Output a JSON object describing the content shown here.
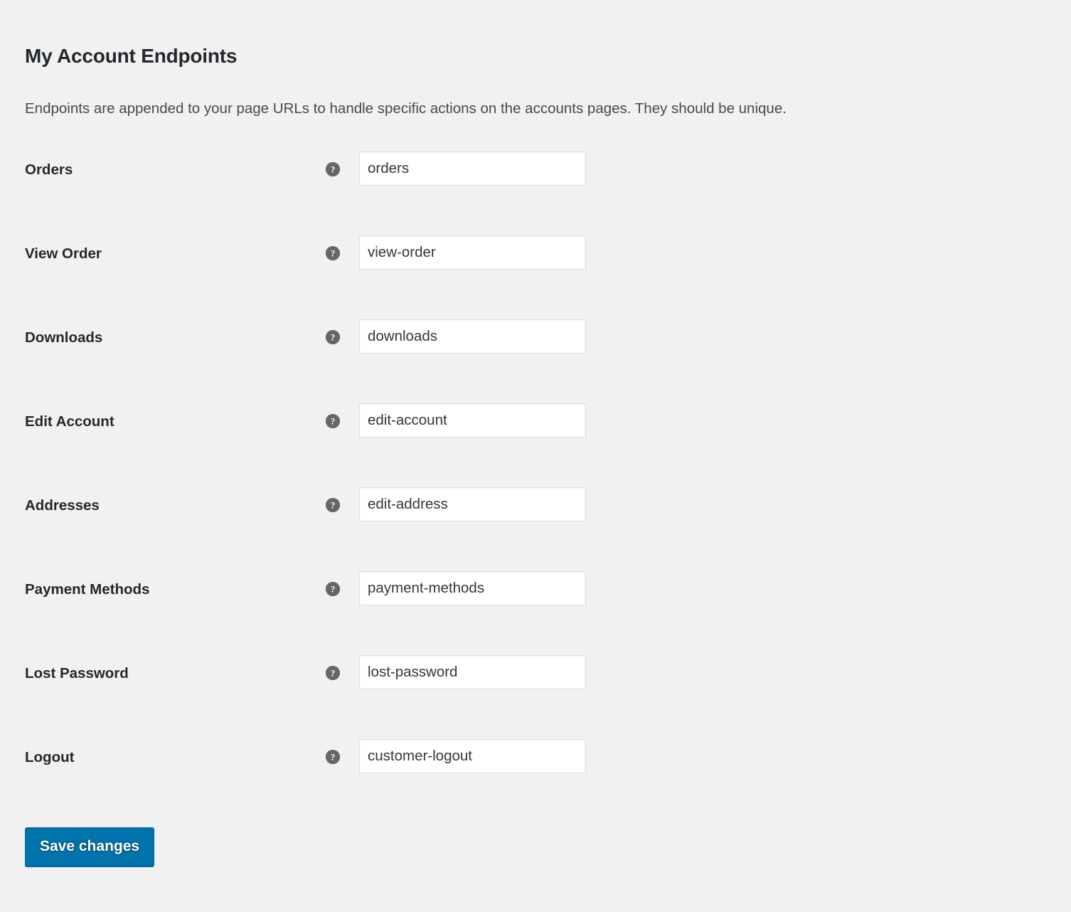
{
  "page": {
    "title": "My Account Endpoints",
    "description": "Endpoints are appended to your page URLs to handle specific actions on the accounts pages. They should be unique."
  },
  "colors": {
    "background": "#f1f1f1",
    "heading": "#23282d",
    "input_border": "#dddddd",
    "help_icon": "#666666",
    "primary_button": "#0073aa"
  },
  "fields": [
    {
      "label": "Orders",
      "value": "orders",
      "help_icon": "help-icon"
    },
    {
      "label": "View Order",
      "value": "view-order",
      "help_icon": "help-icon"
    },
    {
      "label": "Downloads",
      "value": "downloads",
      "help_icon": "help-icon"
    },
    {
      "label": "Edit Account",
      "value": "edit-account",
      "help_icon": "help-icon"
    },
    {
      "label": "Addresses",
      "value": "edit-address",
      "help_icon": "help-icon"
    },
    {
      "label": "Payment Methods",
      "value": "payment-methods",
      "help_icon": "help-icon"
    },
    {
      "label": "Lost Password",
      "value": "lost-password",
      "help_icon": "help-icon"
    },
    {
      "label": "Logout",
      "value": "customer-logout",
      "help_icon": "help-icon"
    }
  ],
  "submit": {
    "save_label": "Save changes"
  }
}
